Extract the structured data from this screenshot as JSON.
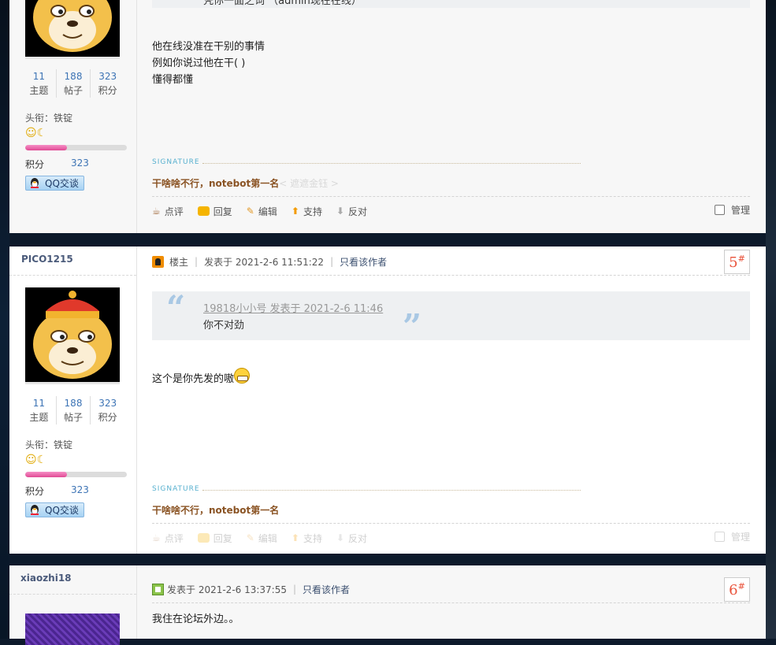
{
  "posts": [
    {
      "quote_tail": "凭你一面之词 （admin现在在线）",
      "body_lines": [
        "他在线没准在干别的事情",
        "例如你说过他在干(      )",
        "懂得都懂"
      ],
      "author": {
        "stats": [
          {
            "num": "11",
            "label": "主题"
          },
          {
            "num": "188",
            "label": "帖子"
          },
          {
            "num": "323",
            "label": "积分"
          }
        ],
        "honor": "头衔：铁锭",
        "level_fraction": 0.41,
        "points_label": "积分",
        "points_value": "323",
        "qq_label": "QQ交谈"
      },
      "signature": {
        "label": "SIGNATURE",
        "text": "干啥啥不行，notebot第一名",
        "link": "< 遮遮金钰 >"
      },
      "actions": {
        "rate": "点评",
        "reply": "回复",
        "edit": "编辑",
        "support": "支持",
        "oppose": "反对",
        "manage": "管理"
      }
    },
    {
      "author_name": "PICO1215",
      "badge": "楼主",
      "posted": "发表于 2021-2-6 11:51:22",
      "only_author": "只看该作者",
      "floor": "5",
      "floor_mark": "#",
      "quote_head": "19818小小号 发表于 2021-2-6 11:46",
      "quote_body": "你不对劲",
      "body": "这个是你先发的嗷",
      "author": {
        "stats": [
          {
            "num": "11",
            "label": "主题"
          },
          {
            "num": "188",
            "label": "帖子"
          },
          {
            "num": "323",
            "label": "积分"
          }
        ],
        "honor": "头衔：铁锭",
        "level_fraction": 0.41,
        "points_label": "积分",
        "points_value": "323",
        "qq_label": "QQ交谈"
      },
      "signature": {
        "label": "SIGNATURE",
        "text": "干啥啥不行，notebot第一名"
      },
      "actions": {
        "rate": "点评",
        "reply": "回复",
        "edit": "编辑",
        "support": "支持",
        "oppose": "反对",
        "manage": "管理"
      }
    },
    {
      "author_name": "xiaozhi18",
      "posted": "发表于 2021-2-6 13:37:55",
      "only_author": "只看该作者",
      "floor": "6",
      "floor_mark": "#",
      "body": "我住在论坛外边。。"
    }
  ],
  "colors": {
    "accent_link": "#3d74b5",
    "floor_number": "#e9533b",
    "signature": "#8a5323",
    "level_bar": "#e04a94"
  }
}
